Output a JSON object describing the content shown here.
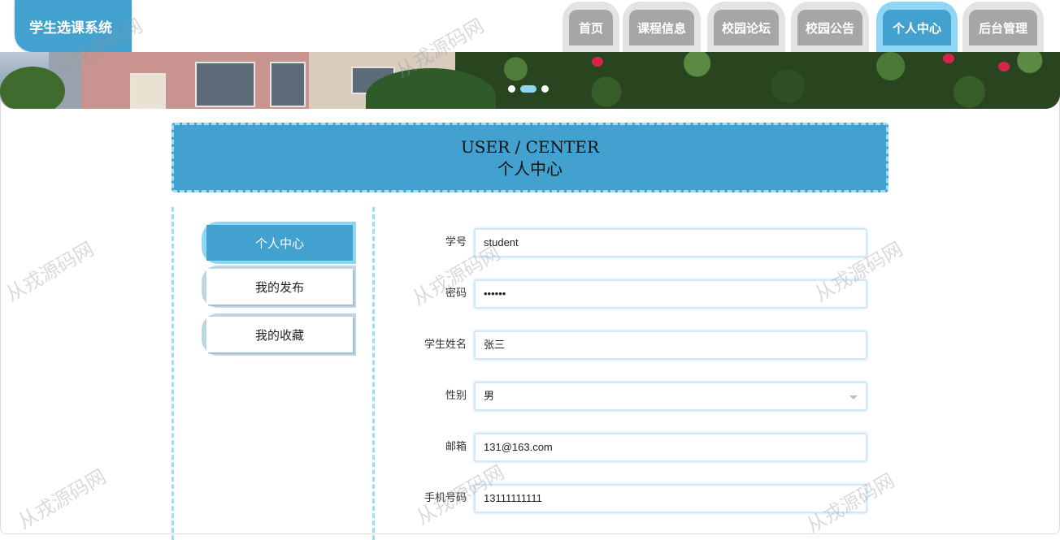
{
  "header": {
    "logo": "学生选课系统",
    "nav": [
      {
        "label": "首页",
        "active": false
      },
      {
        "label": "课程信息",
        "active": false
      },
      {
        "label": "校园论坛",
        "active": false
      },
      {
        "label": "校园公告",
        "active": false
      },
      {
        "label": "个人中心",
        "active": true
      },
      {
        "label": "后台管理",
        "active": false
      }
    ]
  },
  "banner": {
    "dots": 3,
    "active_dot": 2
  },
  "title": {
    "en": "USER / CENTER",
    "cn": "个人中心"
  },
  "sidebar": {
    "items": [
      {
        "label": "个人中心",
        "active": true
      },
      {
        "label": "我的发布",
        "active": false
      },
      {
        "label": "我的收藏",
        "active": false
      }
    ]
  },
  "form": {
    "student_id": {
      "label": "学号",
      "value": "student"
    },
    "password": {
      "label": "密码",
      "value": "••••••"
    },
    "name": {
      "label": "学生姓名",
      "value": "张三"
    },
    "gender": {
      "label": "性别",
      "value": "男"
    },
    "email": {
      "label": "邮箱",
      "value": "131@163.com"
    },
    "phone": {
      "label": "手机号码",
      "value": "13111111111"
    }
  },
  "watermark": "从戎源码网",
  "colors": {
    "primary": "#43a1cf",
    "accent": "#8fd6f5",
    "nav_inactive": "#a6a6a6"
  }
}
